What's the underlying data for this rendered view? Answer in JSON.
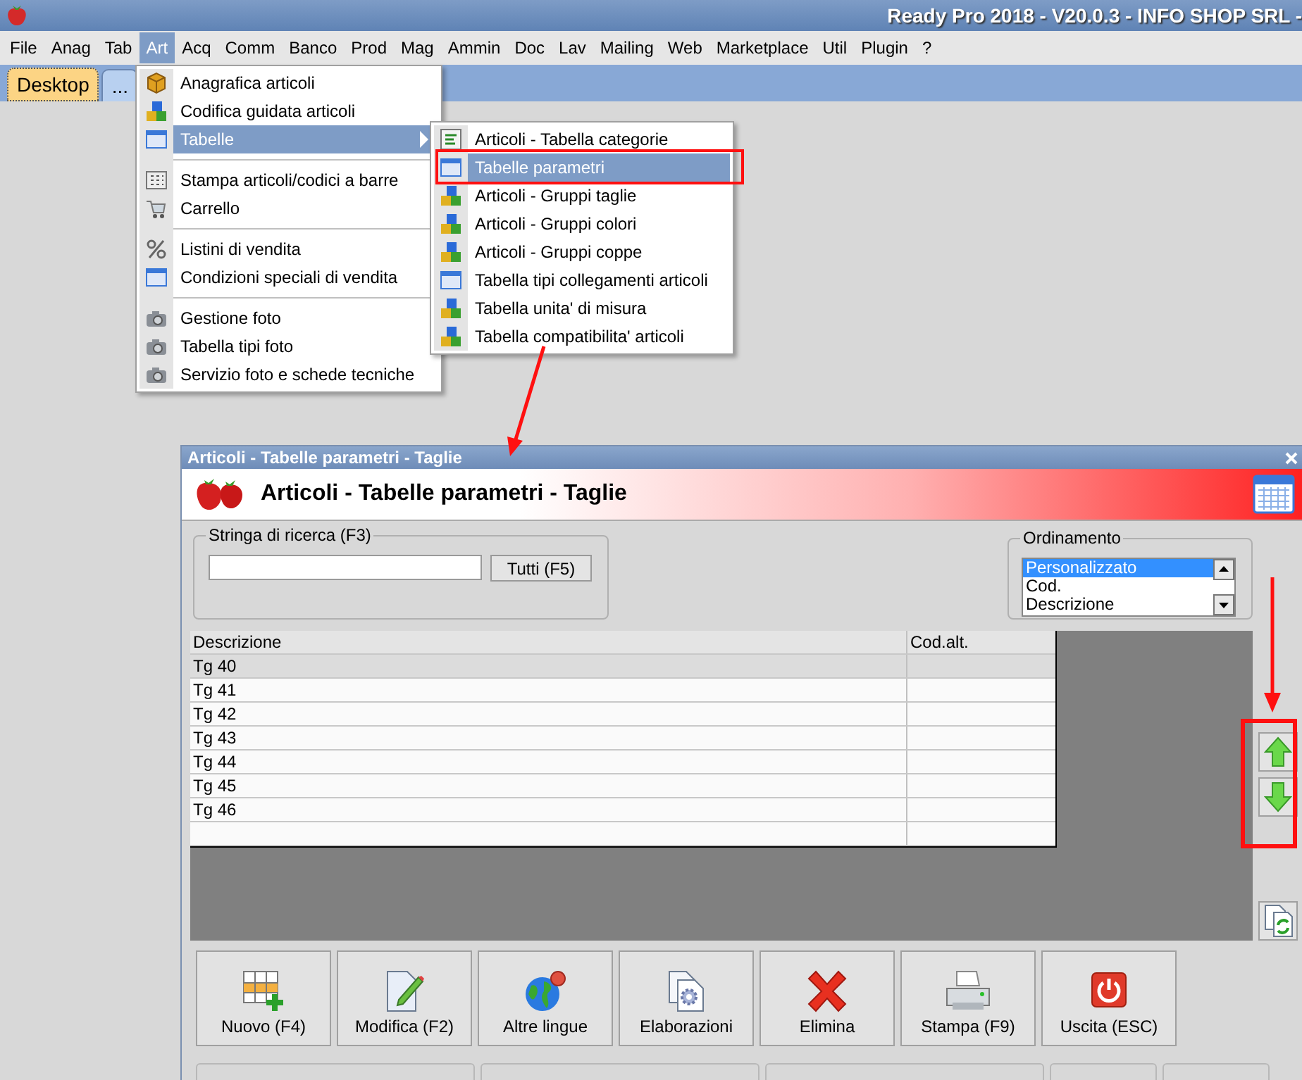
{
  "window": {
    "title": "Ready Pro 2018 - V20.0.3 - INFO SHOP SRL -"
  },
  "menubar": [
    {
      "label": "File",
      "selected": false
    },
    {
      "label": "Anag",
      "selected": false
    },
    {
      "label": "Tab",
      "selected": false
    },
    {
      "label": "Art",
      "selected": true
    },
    {
      "label": "Acq",
      "selected": false
    },
    {
      "label": "Comm",
      "selected": false
    },
    {
      "label": "Banco",
      "selected": false
    },
    {
      "label": "Prod",
      "selected": false
    },
    {
      "label": "Mag",
      "selected": false
    },
    {
      "label": "Ammin",
      "selected": false
    },
    {
      "label": "Doc",
      "selected": false
    },
    {
      "label": "Lav",
      "selected": false
    },
    {
      "label": "Mailing",
      "selected": false
    },
    {
      "label": "Web",
      "selected": false
    },
    {
      "label": "Marketplace",
      "selected": false
    },
    {
      "label": "Util",
      "selected": false
    },
    {
      "label": "Plugin",
      "selected": false
    },
    {
      "label": "?",
      "selected": false
    }
  ],
  "desktop_tabs": [
    {
      "label": "Desktop",
      "selected": true
    },
    {
      "label": "...",
      "selected": false
    }
  ],
  "art_menu": {
    "items": [
      {
        "label": "Anagrafica articoli",
        "kind": "box",
        "separator_before": false,
        "submenu": false,
        "selected": false
      },
      {
        "label": "Codifica guidata articoli",
        "kind": "blocks",
        "separator_before": false,
        "submenu": false,
        "selected": false
      },
      {
        "label": "Tabelle",
        "kind": "table",
        "separator_before": false,
        "submenu": true,
        "selected": true
      },
      {
        "label": "Stampa articoli/codici a barre",
        "kind": "grid",
        "separator_before": true,
        "submenu": false,
        "selected": false
      },
      {
        "label": "Carrello",
        "kind": "cart",
        "separator_before": false,
        "submenu": false,
        "selected": false
      },
      {
        "label": "Listini di vendita",
        "kind": "percent",
        "separator_before": true,
        "submenu": false,
        "selected": false
      },
      {
        "label": "Condizioni speciali di vendita",
        "kind": "table",
        "separator_before": false,
        "submenu": false,
        "selected": false
      },
      {
        "label": "Gestione foto",
        "kind": "camera",
        "separator_before": true,
        "submenu": false,
        "selected": false
      },
      {
        "label": "Tabella tipi foto",
        "kind": "camera",
        "separator_before": false,
        "submenu": false,
        "selected": false
      },
      {
        "label": "Servizio foto e schede tecniche",
        "kind": "camera",
        "separator_before": false,
        "submenu": false,
        "selected": false
      }
    ]
  },
  "submenu": {
    "items": [
      {
        "label": "Articoli - Tabella categorie",
        "kind": "list",
        "selected": false
      },
      {
        "label": "Tabelle parametri",
        "kind": "table",
        "selected": true
      },
      {
        "label": "Articoli - Gruppi taglie",
        "kind": "blocks",
        "selected": false
      },
      {
        "label": "Articoli - Gruppi colori",
        "kind": "blocks",
        "selected": false
      },
      {
        "label": "Articoli - Gruppi coppe",
        "kind": "blocks",
        "selected": false
      },
      {
        "label": "Tabella tipi collegamenti articoli",
        "kind": "table",
        "selected": false
      },
      {
        "label": "Tabella unita' di misura",
        "kind": "blocks",
        "selected": false
      },
      {
        "label": "Tabella compatibilita' articoli",
        "kind": "blocks",
        "selected": false
      }
    ]
  },
  "dialog": {
    "title": "Articoli - Tabelle parametri - Taglie",
    "header": "Articoli - Tabelle parametri - Taglie",
    "search": {
      "label": "Stringa di ricerca (F3)",
      "button": "Tutti (F5)"
    },
    "ordering": {
      "label": "Ordinamento",
      "options": [
        {
          "label": "Personalizzato",
          "selected": true
        },
        {
          "label": "Cod.",
          "selected": false
        },
        {
          "label": "Descrizione",
          "selected": false
        }
      ]
    },
    "table": {
      "columns": [
        "Descrizione",
        "Cod.alt."
      ],
      "rows": [
        {
          "descrizione": "Tg 40",
          "selected": true
        },
        {
          "descrizione": "Tg 41",
          "selected": false
        },
        {
          "descrizione": "Tg 42",
          "selected": false
        },
        {
          "descrizione": "Tg 43",
          "selected": false
        },
        {
          "descrizione": "Tg 44",
          "selected": false
        },
        {
          "descrizione": "Tg 45",
          "selected": false
        },
        {
          "descrizione": "Tg 46",
          "selected": false
        }
      ]
    },
    "buttons": [
      {
        "label": "Nuovo (F4)",
        "kind": "new"
      },
      {
        "label": "Modifica (F2)",
        "kind": "edit"
      },
      {
        "label": "Altre lingue",
        "kind": "globe"
      },
      {
        "label": "Elaborazioni",
        "kind": "process"
      },
      {
        "label": "Elimina",
        "kind": "delete"
      },
      {
        "label": "Stampa (F9)",
        "kind": "print"
      },
      {
        "label": "Uscita (ESC)",
        "kind": "exit"
      }
    ]
  }
}
